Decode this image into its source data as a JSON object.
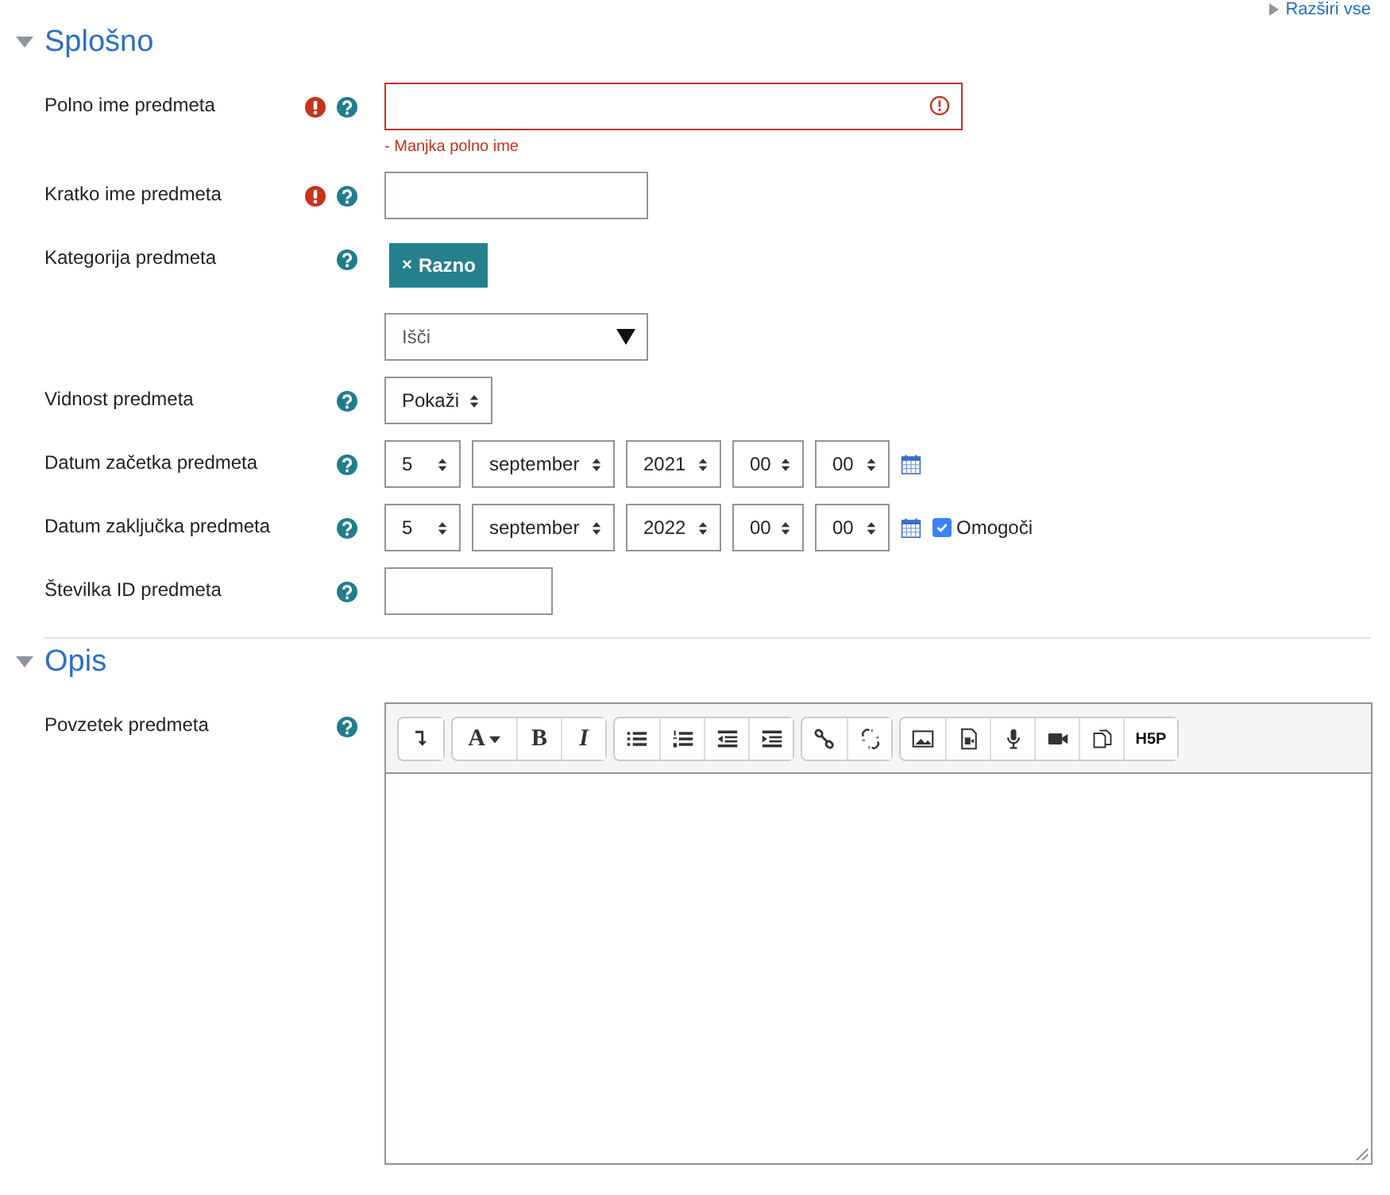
{
  "expand_all_link": "Razširi vse",
  "sections": [
    {
      "title": "Splošno",
      "expanded": true,
      "fields": [
        {
          "kind": "text",
          "label": "Polno ime predmeta",
          "required": true,
          "invalid": true,
          "error": "- Manjka polno ime"
        },
        {
          "kind": "text",
          "label": "Kratko ime predmeta",
          "required": true,
          "invalid": false
        },
        {
          "kind": "autocomplete",
          "label": "Kategorija predmeta",
          "required": false,
          "chip": {
            "remove_symbol": "×",
            "label": "Razno"
          },
          "placeholder": "Išči"
        },
        {
          "kind": "select",
          "label": "Vidnost predmeta",
          "required": false,
          "value": "Pokaži"
        },
        {
          "kind": "date",
          "label": "Datum začetka predmeta",
          "required": false,
          "parts": [
            "5",
            "september",
            "2021",
            "00",
            "00"
          ]
        },
        {
          "kind": "date",
          "label": "Datum zaključka predmeta",
          "required": false,
          "parts": [
            "5",
            "september",
            "2022",
            "00",
            "00"
          ],
          "enable": {
            "label": "Omogoči",
            "checked": true
          }
        },
        {
          "kind": "text",
          "label": "Številka ID predmeta",
          "required": false,
          "invalid": false
        }
      ]
    },
    {
      "title": "Opis",
      "expanded": true,
      "fields": [
        {
          "kind": "editor",
          "label": "Povzetek predmeta",
          "required": false,
          "toolbar": [
            [
              {
                "kind": "collapse"
              }
            ],
            [
              {
                "kind": "fontcolor",
                "label": "A"
              },
              {
                "kind": "bold",
                "label": "B"
              },
              {
                "kind": "italic",
                "label": "I"
              }
            ],
            [
              {
                "kind": "bullets"
              },
              {
                "kind": "numbers"
              },
              {
                "kind": "outdent"
              },
              {
                "kind": "indent"
              }
            ],
            [
              {
                "kind": "link"
              },
              {
                "kind": "unlink"
              }
            ],
            [
              {
                "kind": "image"
              },
              {
                "kind": "media"
              },
              {
                "kind": "audio"
              },
              {
                "kind": "video"
              },
              {
                "kind": "files"
              },
              {
                "kind": "h5p",
                "label": "H5P"
              }
            ]
          ]
        }
      ]
    }
  ]
}
